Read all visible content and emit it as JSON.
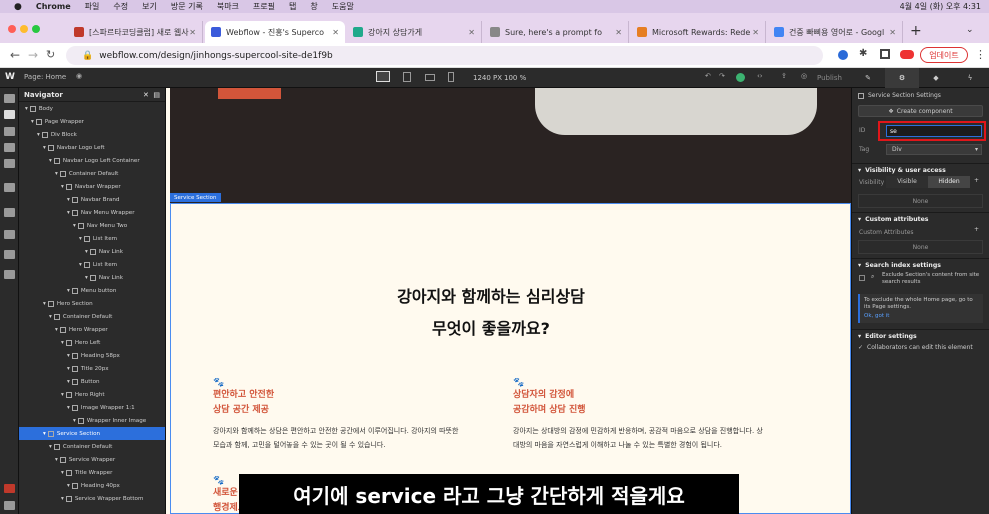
{
  "mac_menu": {
    "app": "Chrome",
    "items": [
      "파일",
      "수정",
      "보기",
      "방문 기록",
      "북마크",
      "프로필",
      "탭",
      "창",
      "도움말"
    ],
    "clock": "4월 4일 (화) 오후 4:31"
  },
  "tabs": [
    {
      "label": "[스파르타코딩클럽] 새로 웹사",
      "active": false,
      "color": "#c0392b"
    },
    {
      "label": "Webflow - 진홍's Superco",
      "active": true,
      "color": "#3b5bdb"
    },
    {
      "label": "강아지 상담가게",
      "active": false,
      "color": "#20a98b"
    },
    {
      "label": "Sure, here's a prompt fo",
      "active": false,
      "color": "#888888"
    },
    {
      "label": "Microsoft Rewards: Rede",
      "active": false,
      "color": "#e67e22"
    },
    {
      "label": "건중 빠삐용 영어로 - Googl",
      "active": false,
      "color": "#4285f4"
    }
  ],
  "address": {
    "url": "webflow.com/design/jinhongs-supercool-site-de1f9b",
    "update_label": "업데이트"
  },
  "toolbar": {
    "page": "Page: Home",
    "width": "1240 PX",
    "zoom": "100 %",
    "publish": "Publish"
  },
  "navigator": {
    "title": "Navigator",
    "items": [
      {
        "label": "Body",
        "depth": 0
      },
      {
        "label": "Page Wrapper",
        "depth": 1
      },
      {
        "label": "Div Block",
        "depth": 2
      },
      {
        "label": "Navbar Logo Left",
        "depth": 3
      },
      {
        "label": "Navbar Logo Left Container",
        "depth": 4
      },
      {
        "label": "Container Default",
        "depth": 5
      },
      {
        "label": "Navbar Wrapper",
        "depth": 6
      },
      {
        "label": "Navbar Brand",
        "depth": 7
      },
      {
        "label": "Nav Menu Wrapper",
        "depth": 7
      },
      {
        "label": "Nav Menu Two",
        "depth": 8
      },
      {
        "label": "List Item",
        "depth": 9
      },
      {
        "label": "Nav Link",
        "depth": 10
      },
      {
        "label": "List Item",
        "depth": 9
      },
      {
        "label": "Nav Link",
        "depth": 10
      },
      {
        "label": "Menu button",
        "depth": 7
      },
      {
        "label": "Hero Section",
        "depth": 3
      },
      {
        "label": "Container Default",
        "depth": 4
      },
      {
        "label": "Hero Wrapper",
        "depth": 5
      },
      {
        "label": "Hero Left",
        "depth": 6
      },
      {
        "label": "Heading 58px",
        "depth": 7
      },
      {
        "label": "Title 20px",
        "depth": 7
      },
      {
        "label": "Button",
        "depth": 7
      },
      {
        "label": "Hero Right",
        "depth": 6
      },
      {
        "label": "Image Wrapper 1:1",
        "depth": 7
      },
      {
        "label": "Wrapper Inner Image",
        "depth": 8
      },
      {
        "label": "Service Section",
        "depth": 3,
        "selected": true
      },
      {
        "label": "Container Default",
        "depth": 4
      },
      {
        "label": "Service Wrapper",
        "depth": 5
      },
      {
        "label": "Title Wrapper",
        "depth": 6
      },
      {
        "label": "Heading 40px",
        "depth": 7
      },
      {
        "label": "Service Wrapper Bottom",
        "depth": 6
      }
    ]
  },
  "canvas": {
    "section_label": "Service Section",
    "title_line1": "강아지와 함께하는 심리상담",
    "title_line2": "무엇이 좋을까요?",
    "features": [
      {
        "h1": "편안하고 안전한",
        "h2": "상담 공간 제공",
        "p1": "강아지와 함께하는 상담은 편안하고 안전한 공간에서 이루어집니다. 강아지의 따뜻한",
        "p2": "모습과 함께, 고민을 털어놓을 수 있는 곳이 될 수 있습니다."
      },
      {
        "h1": "상담자의 감정에",
        "h2": "공감하며 상담 진행",
        "p1": "강아지는 상대방의 감정에 민감하게 반응하며, 공감적 마음으로 상담을 진행합니다. 상",
        "p2": "대방의 마음을 자연스럽게 이해하고 나눌 수 있는 특별한 경험이 됩니다."
      }
    ],
    "partial_heading": "새로운 시",
    "partial_heading2": "행경제로 서"
  },
  "caption": "여기에 service 라고 그냥 간단하게 적을게요",
  "settings": {
    "header": "Service Section Settings",
    "create_component": "Create component",
    "id_label": "ID",
    "id_value": "se",
    "tag_label": "Tag",
    "tag_value": "Div",
    "visibility_header": "Visibility & user access",
    "visibility_label": "Visibility",
    "visible": "Visible",
    "hidden": "Hidden",
    "none1": "None",
    "custom_attr_header": "Custom attributes",
    "custom_attr_label": "Custom Attributes",
    "none2": "None",
    "search_header": "Search index settings",
    "exclude_text": "Exclude Section's content from site search results",
    "tip_text": "To exclude the whole Home page, go to its Page settings.",
    "ok": "Ok, got it",
    "editor_header": "Editor settings",
    "collab_text": "Collaborators can edit this element"
  }
}
